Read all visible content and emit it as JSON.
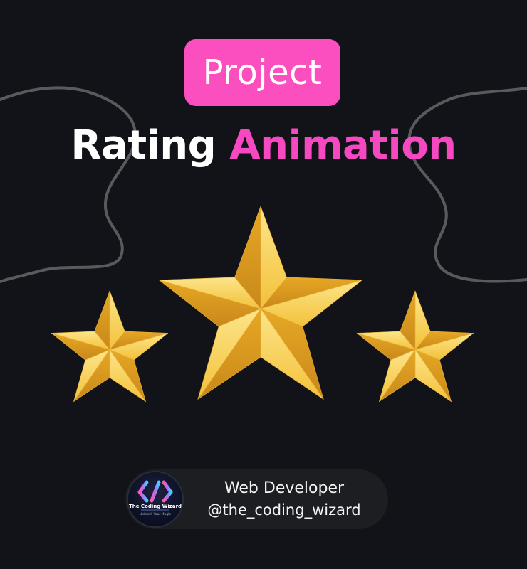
{
  "badge": {
    "label": "Project"
  },
  "headline": {
    "word1": "Rating",
    "word2": "Animation"
  },
  "rating": {
    "stars_shown": 3
  },
  "colors": {
    "background": "#121318",
    "accent_pink": "#fb4fc0",
    "star_gold": "#f5c542",
    "wave_line": "#5a5a5e"
  },
  "profile": {
    "logo_brand": "The Coding Wizard",
    "logo_tagline": "Unleash Your Magic",
    "role": "Web Developer",
    "handle": "@the_coding_wizard"
  },
  "icons": [
    "code-brackets-logo-icon",
    "star-icon"
  ]
}
